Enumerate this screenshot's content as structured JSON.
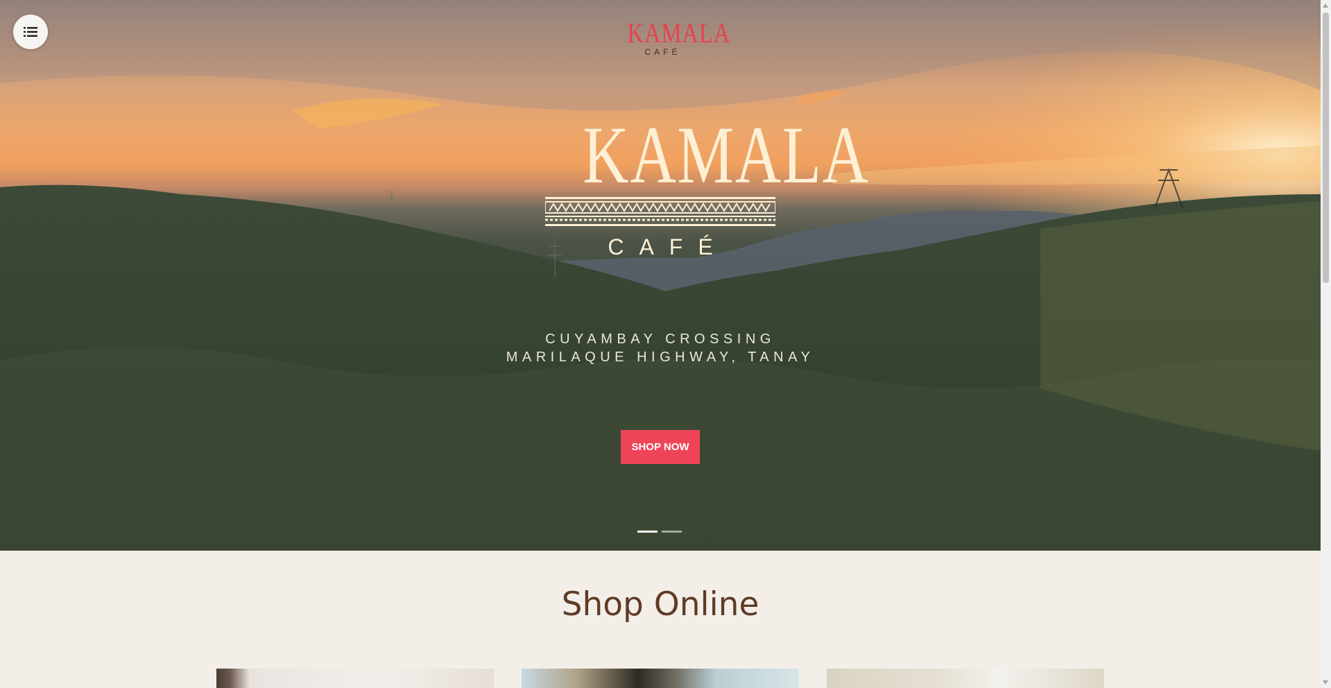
{
  "header": {
    "menu_icon": "list-icon",
    "logo": {
      "name": "KAMALA",
      "sub": "CAFÉ",
      "color": "#e8404e"
    }
  },
  "hero": {
    "logo": {
      "name": "KAMALA",
      "sub": "CAFÉ"
    },
    "address_line1": "CUYAMBAY CROSSING",
    "address_line2": "MARILAQUE HIGHWAY, TANAY",
    "cta_label": "SHOP NOW",
    "cta_color": "#ef4458",
    "slides_total": 2,
    "slide_active": 1
  },
  "shop": {
    "heading": "Shop Online",
    "heading_color": "#5e3b26"
  }
}
